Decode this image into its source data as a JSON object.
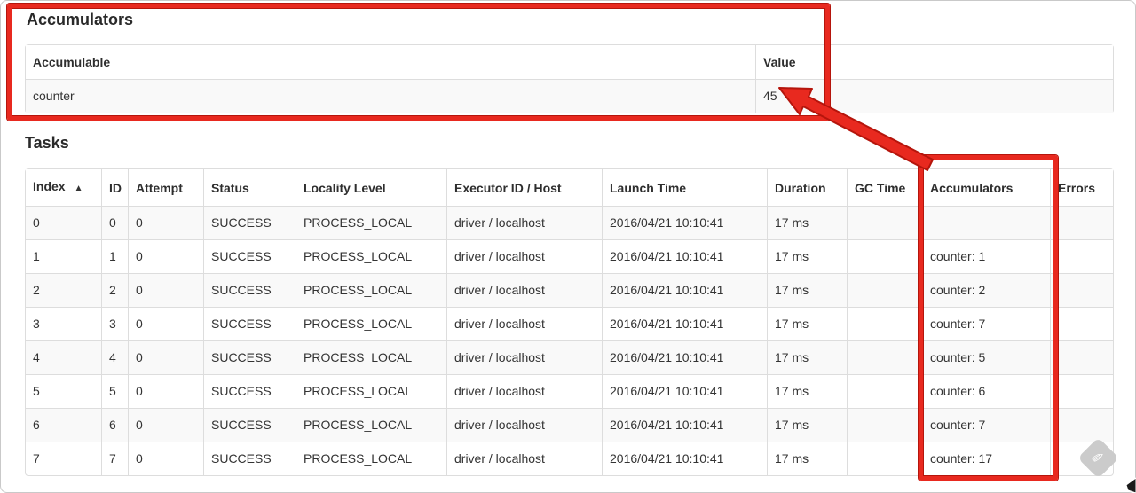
{
  "accumulators_section": {
    "heading": "Accumulators",
    "table": {
      "columns": [
        "Accumulable",
        "Value"
      ],
      "rows": [
        {
          "accumulable": "counter",
          "value": "45"
        }
      ]
    }
  },
  "tasks_section": {
    "heading": "Tasks",
    "table": {
      "columns": [
        "Index",
        "ID",
        "Attempt",
        "Status",
        "Locality Level",
        "Executor ID / Host",
        "Launch Time",
        "Duration",
        "GC Time",
        "Accumulators",
        "Errors"
      ],
      "sort_icon": "▲",
      "rows": [
        {
          "index": "0",
          "id": "0",
          "attempt": "0",
          "status": "SUCCESS",
          "locality_level": "PROCESS_LOCAL",
          "executor_id_host": "driver / localhost",
          "launch_time": "2016/04/21 10:10:41",
          "duration": "17 ms",
          "gc_time": "",
          "accumulators": "",
          "errors": ""
        },
        {
          "index": "1",
          "id": "1",
          "attempt": "0",
          "status": "SUCCESS",
          "locality_level": "PROCESS_LOCAL",
          "executor_id_host": "driver / localhost",
          "launch_time": "2016/04/21 10:10:41",
          "duration": "17 ms",
          "gc_time": "",
          "accumulators": "counter: 1",
          "errors": ""
        },
        {
          "index": "2",
          "id": "2",
          "attempt": "0",
          "status": "SUCCESS",
          "locality_level": "PROCESS_LOCAL",
          "executor_id_host": "driver / localhost",
          "launch_time": "2016/04/21 10:10:41",
          "duration": "17 ms",
          "gc_time": "",
          "accumulators": "counter: 2",
          "errors": ""
        },
        {
          "index": "3",
          "id": "3",
          "attempt": "0",
          "status": "SUCCESS",
          "locality_level": "PROCESS_LOCAL",
          "executor_id_host": "driver / localhost",
          "launch_time": "2016/04/21 10:10:41",
          "duration": "17 ms",
          "gc_time": "",
          "accumulators": "counter: 7",
          "errors": ""
        },
        {
          "index": "4",
          "id": "4",
          "attempt": "0",
          "status": "SUCCESS",
          "locality_level": "PROCESS_LOCAL",
          "executor_id_host": "driver / localhost",
          "launch_time": "2016/04/21 10:10:41",
          "duration": "17 ms",
          "gc_time": "",
          "accumulators": "counter: 5",
          "errors": ""
        },
        {
          "index": "5",
          "id": "5",
          "attempt": "0",
          "status": "SUCCESS",
          "locality_level": "PROCESS_LOCAL",
          "executor_id_host": "driver / localhost",
          "launch_time": "2016/04/21 10:10:41",
          "duration": "17 ms",
          "gc_time": "",
          "accumulators": "counter: 6",
          "errors": ""
        },
        {
          "index": "6",
          "id": "6",
          "attempt": "0",
          "status": "SUCCESS",
          "locality_level": "PROCESS_LOCAL",
          "executor_id_host": "driver / localhost",
          "launch_time": "2016/04/21 10:10:41",
          "duration": "17 ms",
          "gc_time": "",
          "accumulators": "counter: 7",
          "errors": ""
        },
        {
          "index": "7",
          "id": "7",
          "attempt": "0",
          "status": "SUCCESS",
          "locality_level": "PROCESS_LOCAL",
          "executor_id_host": "driver / localhost",
          "launch_time": "2016/04/21 10:10:41",
          "duration": "17 ms",
          "gc_time": "",
          "accumulators": "counter: 17",
          "errors": ""
        }
      ]
    }
  },
  "annotations": {
    "highlight_color": "#e8291f",
    "pencil_glyph": "✏"
  }
}
